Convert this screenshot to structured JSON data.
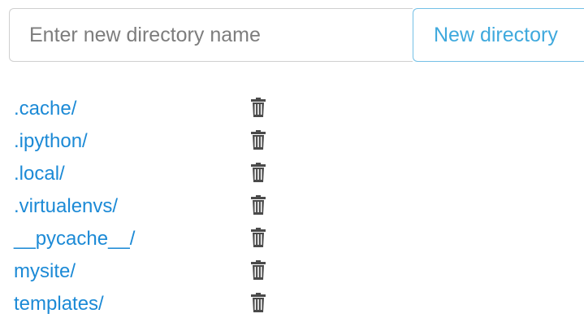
{
  "form": {
    "input_placeholder": "Enter new directory name",
    "input_value": "",
    "button_label": "New directory"
  },
  "directories": [
    {
      "name": ".cache/",
      "action_icon": "trash-icon"
    },
    {
      "name": ".ipython/",
      "action_icon": "trash-icon"
    },
    {
      "name": ".local/",
      "action_icon": "trash-icon"
    },
    {
      "name": ".virtualenvs/",
      "action_icon": "trash-icon"
    },
    {
      "name": "__pycache__/",
      "action_icon": "trash-icon"
    },
    {
      "name": "mysite/",
      "action_icon": "trash-icon"
    },
    {
      "name": "templates/",
      "action_icon": "trash-icon"
    }
  ],
  "colors": {
    "link": "#1c8ad6",
    "button_text": "#3fa9dd",
    "button_border": "#74c0e6",
    "input_border": "#cfcfcf",
    "icon": "#4a4a4a"
  }
}
